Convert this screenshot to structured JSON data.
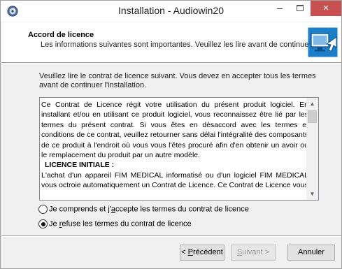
{
  "window": {
    "title": "Installation - Audiowin20",
    "minimize_glyph": "–",
    "close_glyph": "×"
  },
  "header": {
    "title": "Accord de licence",
    "subtitle": "Les informations suivantes sont importantes. Veuillez les lire avant de continuer."
  },
  "intro": "Veuillez lire le contrat de licence suivant. Vous devez en accepter tous les termes avant de continuer l'installation.",
  "license": {
    "paragraph1": "Ce Contrat de Licence régit votre utilisation du présent produit logiciel. En installant et/ou en utilisant ce produit logiciel, vous reconnaissez être lié par les termes du présent contrat. Si vous êtes en désaccord avec les termes et conditions de ce contrat, veuillez retourner sans délai l'intégralité des composants de ce produit à l'endroit où vous vous l'êtes procuré afin d'en obtenir un avoir ou le remplacement du produit par un autre modèle.",
    "heading": "LICENCE INITIALE :",
    "paragraph2": "L'achat d'un appareil FIM MEDICAL informatisé ou d'un logiciel FIM MEDICAL vous octroie automatiquement un Contrat de Licence. Ce Contrat de Licence vous"
  },
  "scrollbar": {
    "up_glyph": "▲",
    "down_glyph": "▼"
  },
  "options": {
    "accept": {
      "pre": "Je comprends et j'",
      "key": "a",
      "post": "ccepte les termes du contrat de licence",
      "checked": false
    },
    "refuse": {
      "pre": "Je ",
      "key": "r",
      "post": "efuse les termes du contrat de licence",
      "checked": true
    }
  },
  "buttons": {
    "back": {
      "pre": "< ",
      "key": "P",
      "post": "récédent"
    },
    "next": {
      "key": "S",
      "post": "uivant >"
    },
    "cancel": "Annuler"
  },
  "colors": {
    "close_button": "#c75050",
    "logo_blue": "#1a7fc8",
    "dialog_background": "#f0f0f0"
  },
  "icons": {
    "app": "installer-disc-icon",
    "header": "monitor-arrow-icon"
  }
}
